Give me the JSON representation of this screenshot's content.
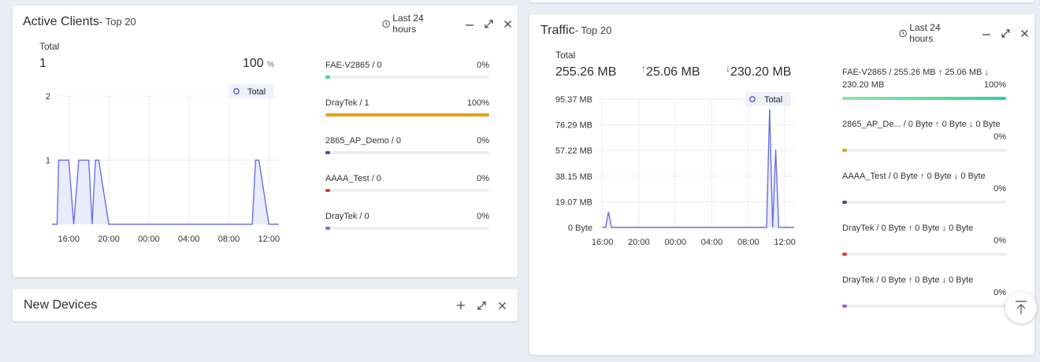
{
  "active_clients": {
    "title": "Active Clients",
    "subtitle": "- Top 20",
    "range_label": "Last 24 hours",
    "total_label": "Total",
    "total_value": "1",
    "percent_value": "100",
    "percent_unit": "%",
    "items": [
      {
        "name": "FAE-V2865 / 0",
        "percent": "0%",
        "fill": 0.01,
        "color": "#3ed68e"
      },
      {
        "name": "DrayTek / 1",
        "percent": "100%",
        "fill": 1.0,
        "color": "#e2a413"
      },
      {
        "name": "2865_AP_Demo / 0",
        "percent": "0%",
        "fill": 0.01,
        "color": "#4b4c8c"
      },
      {
        "name": "AAAA_Test / 0",
        "percent": "0%",
        "fill": 0.01,
        "color": "#d93a3a"
      },
      {
        "name": "DrayTek / 0",
        "percent": "0%",
        "fill": 0.01,
        "color": "#9a60cc"
      }
    ]
  },
  "new_devices": {
    "title": "New Devices"
  },
  "traffic": {
    "title": "Traffic",
    "subtitle": "- Top 20",
    "range_label": "Last 24 hours",
    "total_label": "Total",
    "total_value": "255.26 MB",
    "up_value": "25.06 MB",
    "down_value": "230.20 MB",
    "up_arrow": "↑",
    "down_arrow": "↓",
    "items": [
      {
        "name": "FAE-V2865 / 255.26 MB ↑ 25.06 MB ↓",
        "name2": "230.20 MB",
        "percent": "100%",
        "fill": 1.0,
        "color": "#2dd39a"
      },
      {
        "name": "2865_AP_De... / 0 Byte ↑ 0 Byte ↓ 0 Byte",
        "name2": "",
        "percent": "0%",
        "fill": 0.01,
        "color": "#e2a413"
      },
      {
        "name": "AAAA_Test / 0 Byte ↑ 0 Byte ↓ 0 Byte",
        "name2": "",
        "percent": "0%",
        "fill": 0.01,
        "color": "#4b4c8c"
      },
      {
        "name": "DrayTek / 0 Byte ↑ 0 Byte ↓ 0 Byte",
        "name2": "",
        "percent": "0%",
        "fill": 0.01,
        "color": "#d93a3a"
      },
      {
        "name": "DrayTek / 0 Byte ↑ 0 Byte ↓ 0 Byte",
        "name2": "",
        "percent": "0%",
        "fill": 0.01,
        "color": "#9a60cc"
      }
    ]
  },
  "chart_data": [
    {
      "type": "area",
      "legend": [
        "Total"
      ],
      "legend_position": "top-right",
      "x_ticks": [
        "16:00",
        "20:00",
        "00:00",
        "04:00",
        "08:00",
        "12:00"
      ],
      "y_ticks": [
        "2",
        "1"
      ],
      "ylim": [
        0,
        2
      ],
      "grid": true,
      "series": [
        {
          "name": "Total",
          "x": [
            "14:20",
            "14:50",
            "15:00",
            "16:00",
            "16:30",
            "17:00",
            "17:10",
            "18:00",
            "18:20",
            "18:40",
            "19:00",
            "20:00",
            "00:00",
            "04:00",
            "08:00",
            "10:20",
            "10:40",
            "11:00",
            "12:00",
            "13:00"
          ],
          "values": [
            0,
            0,
            1,
            1,
            0,
            1,
            1,
            1,
            0,
            1,
            1,
            0,
            0,
            0,
            0,
            0,
            1,
            1,
            0,
            0
          ]
        }
      ]
    },
    {
      "type": "area",
      "legend": [
        "Total"
      ],
      "legend_position": "top-right",
      "x_ticks": [
        "16:00",
        "20:00",
        "00:00",
        "04:00",
        "08:00",
        "12:00"
      ],
      "y_ticks": [
        "95.37 MB",
        "76.29 MB",
        "57.22 MB",
        "38.15 MB",
        "19.07 MB",
        "0 Byte"
      ],
      "ylim": [
        0,
        95.37
      ],
      "grid": true,
      "series": [
        {
          "name": "Total",
          "x": [
            "16:00",
            "16:20",
            "16:40",
            "17:00",
            "20:00",
            "00:00",
            "04:00",
            "08:00",
            "10:00",
            "10:20",
            "10:40",
            "11:00",
            "11:20",
            "12:00",
            "13:00"
          ],
          "values": [
            0,
            0,
            11.5,
            0,
            0,
            0,
            0,
            0,
            0,
            88,
            0,
            58,
            0,
            0,
            0
          ]
        }
      ]
    }
  ]
}
